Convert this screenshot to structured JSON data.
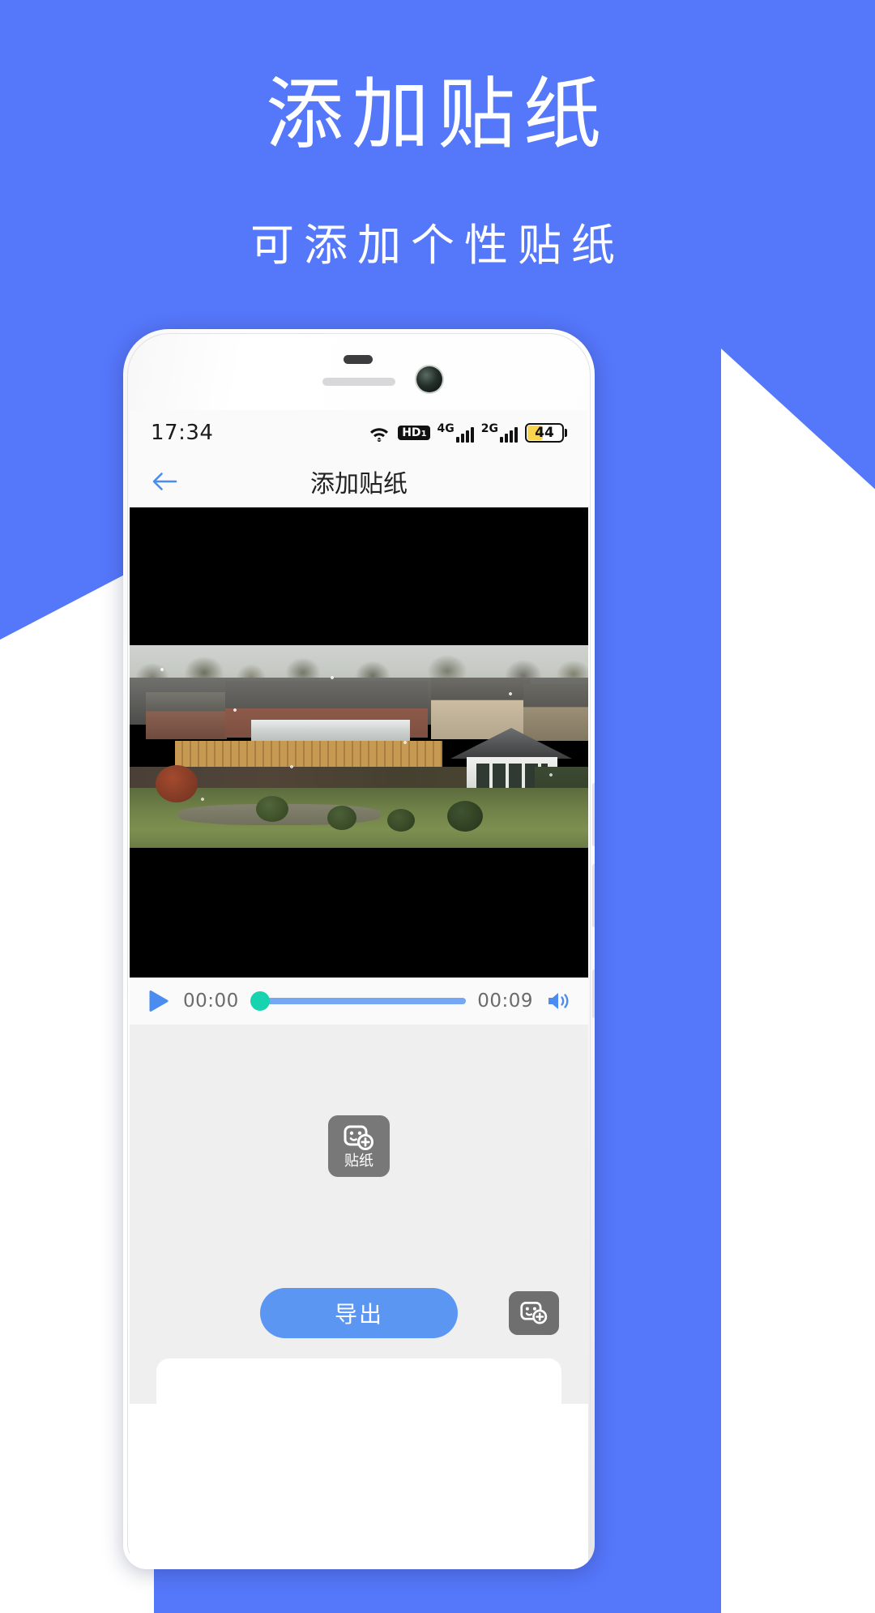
{
  "promo": {
    "title": "添加贴纸",
    "subtitle": "可添加个性贴纸",
    "bg_color": "#5577fa",
    "text_color": "#ffffff"
  },
  "phone": {
    "status_bar": {
      "time": "17:34",
      "icons": [
        "wifi-icon",
        "hd-voice-icon",
        "signal-4g-icon",
        "signal-2g-icon",
        "battery-icon"
      ],
      "hd_label": "HD",
      "hd_sub": "1",
      "network_1": "4G",
      "network_2": "2G",
      "battery_percent": "44",
      "battery_fill_color": "#fcd34d"
    },
    "nav_bar": {
      "back_icon": "arrow-left-icon",
      "title": "添加贴纸",
      "accent_color": "#4a8cf0"
    },
    "player": {
      "play_icon": "play-icon",
      "current_time": "00:00",
      "total_time": "00:09",
      "volume_icon": "volume-up-icon",
      "progress_percent": 0,
      "thumb_color": "#17d3b0",
      "track_color": "#75a7f5"
    },
    "tools": {
      "sticker_tool_label": "贴纸",
      "sticker_tool_icon": "sticker-add-icon"
    },
    "bottom": {
      "export_label": "导出",
      "export_color": "#5b97f2",
      "sticker_quick_icon": "sticker-add-icon"
    }
  }
}
